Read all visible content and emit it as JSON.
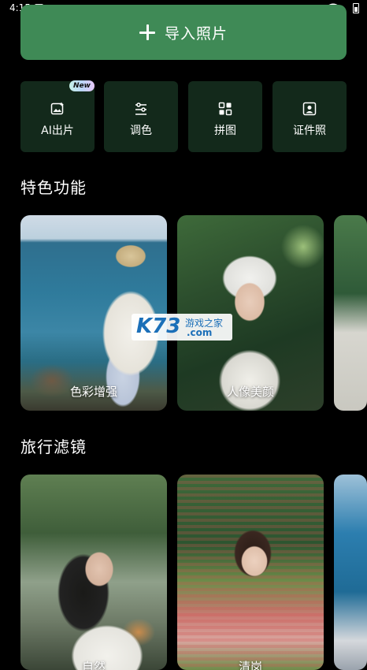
{
  "status_bar": {
    "time": "4:15",
    "notification_glyph": "A"
  },
  "import_button": {
    "label": "导入照片"
  },
  "tools": [
    {
      "label": "AI出片",
      "icon": "ai-image-icon",
      "badge": "New"
    },
    {
      "label": "调色",
      "icon": "sliders-icon"
    },
    {
      "label": "拼图",
      "icon": "grid-icon"
    },
    {
      "label": "证件照",
      "icon": "id-photo-icon"
    }
  ],
  "features": {
    "title": "特色功能",
    "cards": [
      {
        "caption": "色彩增强"
      },
      {
        "caption": "人像美颜"
      }
    ]
  },
  "travel_filters": {
    "title": "旅行滤镜",
    "cards": [
      {
        "caption": "自然"
      },
      {
        "caption": "清岗"
      }
    ]
  },
  "watermark": {
    "brand": "K73",
    "site_cn": "游戏之家",
    "domain": ".com"
  },
  "colors": {
    "accent": "#3f8a56",
    "tool_bg": "#13291b",
    "background": "#000000"
  }
}
